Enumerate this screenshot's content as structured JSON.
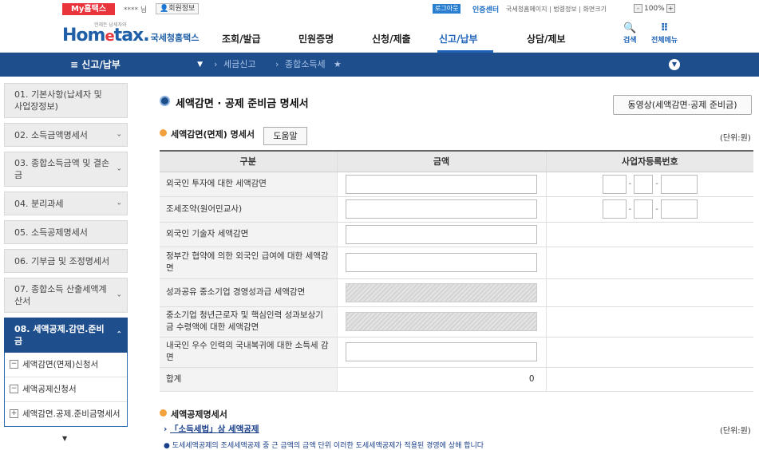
{
  "topbar": {
    "my_label": "My홈택스",
    "user_name": "**** 님",
    "member_info": "회원정보",
    "logout": "로그아웃",
    "cert_center": "인증센터",
    "util_links": "국세청홈페이지 | 법령정보 | 화면크기",
    "zoom_minus": "-",
    "zoom_value": "100%",
    "zoom_plus": "+"
  },
  "header": {
    "logo_main": "Hom",
    "logo_e": "e",
    "logo_tail": "tax.",
    "logo_kr": "국세청홈택스",
    "logo_sub": "언제든 납세자와",
    "nav": [
      "조회/발급",
      "민원증명",
      "신청/제출",
      "신고/납부",
      "상담/제보"
    ],
    "active_nav": "신고/납부",
    "search_label": "검색",
    "allmenu_label": "전체메뉴"
  },
  "location": {
    "menu": "신고/납부",
    "crumbs": [
      "세금신고",
      "종합소득세"
    ]
  },
  "sidebar": {
    "items": [
      {
        "label": "01. 기본사항(납세자 및 사업장정보)",
        "chevron": false
      },
      {
        "label": "02. 소득금액명세서",
        "chevron": true
      },
      {
        "label": "03. 종합소득금액 및 결손금",
        "chevron": true
      },
      {
        "label": "04. 분리과세",
        "chevron": true
      },
      {
        "label": "05. 소득공제명세서",
        "chevron": false
      },
      {
        "label": "06. 기부금 및 조정명세서",
        "chevron": false
      },
      {
        "label": "07. 종합소득 산출세액계산서",
        "chevron": true
      }
    ],
    "active": {
      "label": "08. 세액공제.감면.준비금"
    },
    "subitems": [
      {
        "label": "세액감면(면제)신청서",
        "box": "−"
      },
      {
        "label": "세액공제신청서",
        "box": "−"
      },
      {
        "label": "세액감면.공제.준비금명세서",
        "box": "+"
      }
    ]
  },
  "main": {
    "title": "세액감면 · 공제 준비금 명세서",
    "video_button": "동영상(세액감면·공제 준비금)",
    "section1": "세액감면(면제) 명세서",
    "help_button": "도움말",
    "unit": "(단위:원)",
    "table": {
      "headers": [
        "구분",
        "금액",
        "사업자등록번호"
      ],
      "rows": [
        {
          "label": "외국인 투자에 대한 세액감면",
          "value": "",
          "disabled": false,
          "biz": true
        },
        {
          "label": "조세조약(원어민교사)",
          "value": "",
          "disabled": false,
          "biz": true
        },
        {
          "label": "외국인 기술자 세액감면",
          "value": "",
          "disabled": false,
          "biz": false
        },
        {
          "label": "정부간 협약에 의한 외국인 급여에 대한 세액감면",
          "value": "",
          "disabled": false,
          "biz": false
        },
        {
          "label": "성과공유 중소기업 경영성과급 세액감면",
          "value": "",
          "disabled": true,
          "biz": false
        },
        {
          "label": "중소기업 청년근로자 및 핵심인력 성과보상기금 수령액에 대한 세액감면",
          "value": "",
          "disabled": true,
          "biz": false
        },
        {
          "label": "내국인 우수 인력의 국내복귀에 대한 소득세 감면",
          "value": "",
          "disabled": false,
          "biz": false
        }
      ],
      "total_label": "합계",
      "total_value": "0"
    },
    "section2": "세액공제명세서",
    "link_text": "「소득세법」상 세액공제",
    "unit2": "(단위:원)",
    "cut_text": "● 도세세액공제의 조세세액공제 중 근 금액의 금액 단위 이러한 도세세액공제가 적용된 경영에 상해 합니다"
  }
}
